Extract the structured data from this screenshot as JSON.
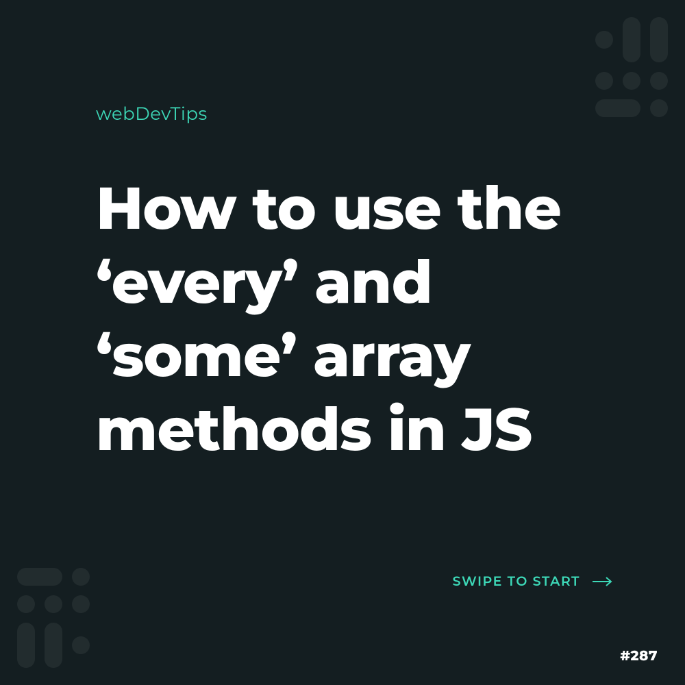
{
  "brand": "webDevTips",
  "title": "How to use the ‘every’ and ‘some’ array methods in JS",
  "cta": {
    "label": "SWIPE TO START"
  },
  "page_number": "#287",
  "colors": {
    "background": "#141e21",
    "accent": "#3dd9b8",
    "text": "#ffffff"
  }
}
